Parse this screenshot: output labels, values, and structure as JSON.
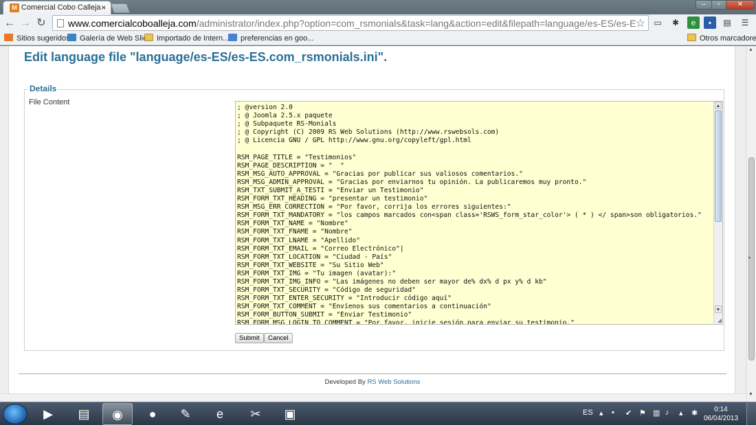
{
  "browser": {
    "tab_title": "Comercial Cobo Calleja -",
    "tab_close": "×",
    "favicon": "M",
    "url_host": "www.comercialcoboalleja.com",
    "url_path": "/administrator/index.php?option=com_rsmonials&task=lang&action=edit&filepath=language/es-ES/es-ES.com_rsmonials.i"
  },
  "bookmarks": {
    "items": [
      {
        "label": "Sitios sugeridos",
        "icon": "bookmark-icon"
      },
      {
        "label": "Galería de Web Slice",
        "icon": "webslice-icon"
      },
      {
        "label": "Importado de Intern...",
        "icon": "folder-icon"
      },
      {
        "label": "preferencias en goo...",
        "icon": "google-icon"
      }
    ],
    "other": "Otros marcadores"
  },
  "page": {
    "title": "Edit language file \"language/es-ES/es-ES.com_rsmonials.ini\".",
    "legend": "Details",
    "file_content_label": "File Content",
    "file_content": "; @version 2.0\n; @ Joomla 2.5.x paquete\n; @ Subpaquete RS-Monials\n; @ Copyright (C) 2009 RS Web Solutions (http://www.rswebsols.com)\n; @ Licencia GNU / GPL http://www.gnu.org/copyleft/gpl.html\n\nRSM_PAGE_TITLE = \"Testimonios\"\nRSM_PAGE_DESCRIPTION = \"  \"\nRSM_MSG_AUTO_APPROVAL = \"Gracias por publicar sus valiosos comentarios.\"\nRSM_MSG_ADMIN_APPROVAL = \"Gracias por enviarnos tu opinión. La publicaremos muy pronto.\"\nRSM_TXT_SUBMIT_A_TESTI = \"Enviar un Testimonio\"\nRSM_FORM_TXT_HEADING = \"presentar un testimonio\"\nRSM_MSG_ERR_CORRECTION = \"Por favor, corrija los errores siguientes:\"\nRSM_FORM_TXT_MANDATORY = \"los campos marcados con<span class='RSWS_form_star_color'> ( * ) </ span>son obligatorios.\"\nRSM_FORM_TXT_NAME = \"Nombre\"\nRSM_FORM_TXT_FNAME = \"Nombre\"\nRSM_FORM_TXT_LNAME = \"Apellido\"\nRSM_FORM_TXT_EMAIL = \"Correo Electrónico\"|\nRSM_FORM_TXT_LOCATION = \"Ciudad - País\"\nRSM_FORM_TXT_WEBSITE = \"Su Sitio Web\"\nRSM_FORM_TXT_IMG = \"Tu imagen (avatar):\"\nRSM_FORM_TXT_IMG_INFO = \"Las imágenes no deben ser mayor de% dx% d px y% d kb\"\nRSM_FORM_TXT_SECURITY = \"Código de seguridad\"\nRSM_FORM_TXT_ENTER_SECURITY = \"Introducir código aquí\"\nRSM_FORM_TXT_COMMENT = \"Envíenos sus comentarios a continuación\"\nRSM_FORM_BUTTON_SUBMIT = \"Enviar Testimonio\"\nRSM_FORM_MSG_LOGIN_TO_COMMENT = \"Por favor, inicie sesión para enviar su testimonio.\"",
    "submit_label": "Submit",
    "cancel_label": "Cancel",
    "footer_prefix": "Developed By",
    "footer_link": "RS Web Solutions"
  },
  "taskbar": {
    "language": "ES",
    "time": "0:14",
    "date": "06/04/2013"
  },
  "colors": {
    "accent": "#2a6f97",
    "editor_bg": "#ffffd2"
  }
}
